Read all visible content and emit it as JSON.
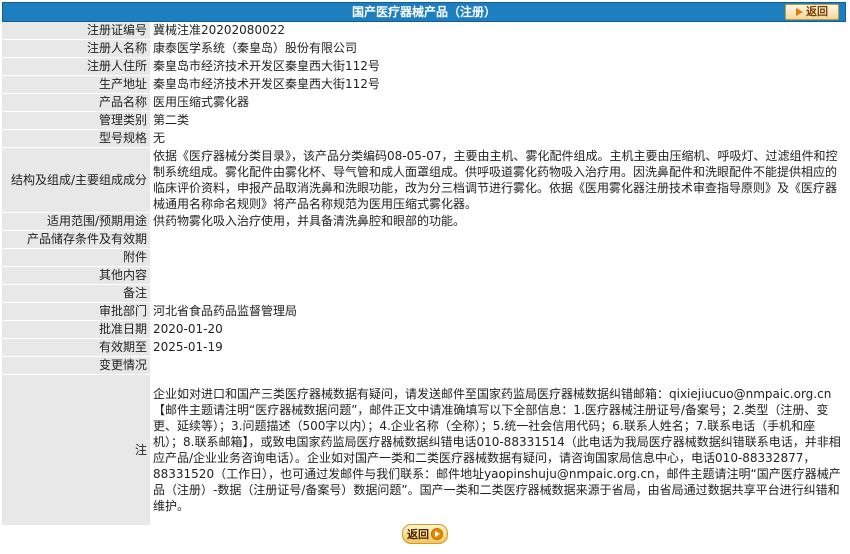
{
  "header": {
    "title": "国产医疗器械产品（注册）",
    "back_label": "返回"
  },
  "rows": [
    {
      "label": "注册证编号",
      "value": "冀械注准20202080022"
    },
    {
      "label": "注册人名称",
      "value": "康泰医学系统（秦皇岛）股份有限公司"
    },
    {
      "label": "注册人住所",
      "value": "秦皇岛市经济技术开发区秦皇西大街112号"
    },
    {
      "label": "生产地址",
      "value": "秦皇岛市经济技术开发区秦皇西大街112号"
    },
    {
      "label": "产品名称",
      "value": "医用压缩式雾化器"
    },
    {
      "label": "管理类别",
      "value": "第二类"
    },
    {
      "label": "型号规格",
      "value": "无"
    },
    {
      "label": "结构及组成/主要组成成分",
      "value": "依据《医疗器械分类目录》，该产品分类编码08-05-07，主要由主机、雾化配件组成。主机主要由压缩机、呼吸灯、过滤组件和控制系统组成。雾化配件由雾化杯、导气管和成人面罩组成。供呼吸道雾化药物吸入治疗用。因洗鼻配件和洗眼配件不能提供相应的临床评价资料，申报产品取消洗鼻和洗眼功能，改为分三档调节进行雾化。依据《医用雾化器注册技术审查指导原则》及《医疗器械通用名称命名规则》将产品名称规范为医用压缩式雾化器。"
    },
    {
      "label": "适用范围/预期用途",
      "value": "供药物雾化吸入治疗使用，并具备清洗鼻腔和眼部的功能。"
    },
    {
      "label": "产品储存条件及有效期",
      "value": ""
    },
    {
      "label": "附件",
      "value": ""
    },
    {
      "label": "其他内容",
      "value": ""
    },
    {
      "label": "备注",
      "value": ""
    },
    {
      "label": "审批部门",
      "value": "河北省食品药品监督管理局"
    },
    {
      "label": "批准日期",
      "value": "2020-01-20"
    },
    {
      "label": "有效期至",
      "value": "2025-01-19"
    },
    {
      "label": "变更情况",
      "value": ""
    },
    {
      "label": "注",
      "value": "企业如对进口和国产三类医疗器械数据有疑问，请发送邮件至国家药监局医疗器械数据纠错邮箱：qixiejiucuo@nmpaic.org.cn【邮件主题请注明“医疗器械数据问题”，邮件正文中请准确填写以下全部信息：1.医疗器械注册证号/备案号；2.类型（注册、变更、延续等）；3.问题描述（500字以内）；4.企业名称（全称）；5.统一社会信用代码；6.联系人姓名；7.联系电话（手机和座机）；8.联系邮箱】，或致电国家药监局医疗器械数据纠错电话010-88331514（此电话为我局医疗器械数据纠错联系电话，并非相应产品/企业业务咨询电话）。企业如对国产一类和二类医疗器械数据有疑问，请咨询国家局信息中心，电话010-88332877，88331520（工作日），也可通过发邮件与我们联系：邮件地址yaopinshuju@nmpaic.org.cn，邮件主题请注明“国产医疗器械产品（注册）-数据（注册证号/备案号）数据问题”。国产一类和二类医疗器械数据来源于省局，由省局通过数据共享平台进行纠错和维护。"
    }
  ],
  "footer": {
    "back_label": "返回"
  }
}
